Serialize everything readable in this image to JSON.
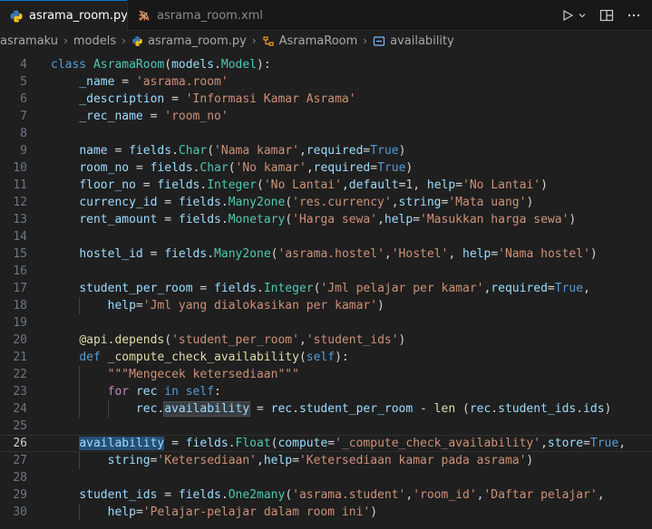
{
  "tabs": [
    {
      "label": "asrama_room.py",
      "icon": "python-icon",
      "active": true,
      "close": "×"
    },
    {
      "label": "asrama_room.xml",
      "icon": "rss-icon",
      "active": false
    }
  ],
  "toolbar": {
    "run_icon": "play-icon",
    "dropdown_icon": "chevron-down-icon",
    "split_icon": "split-editor-icon",
    "more_icon": "ellipsis-icon"
  },
  "breadcrumb": [
    {
      "label": "asramaku",
      "icon": ""
    },
    {
      "label": "models",
      "icon": ""
    },
    {
      "label": "asrama_room.py",
      "icon": "python-icon"
    },
    {
      "label": "AsramaRoom",
      "icon": "class-icon"
    },
    {
      "label": "availability",
      "icon": "field-icon"
    }
  ],
  "colors": {
    "accent": "#0078d4",
    "background": "#1f1f1f",
    "keyword": "#569cd6",
    "string": "#ce9178",
    "class": "#4ec9b0",
    "function": "#dcdcaa",
    "variable": "#9cdcfe"
  },
  "editor": {
    "current_line": 26,
    "lines": [
      {
        "n": "4",
        "text": "class AsramaRoom(models.Model):"
      },
      {
        "n": "5",
        "text": "    _name = 'asrama.room'"
      },
      {
        "n": "6",
        "text": "    _description = 'Informasi Kamar Asrama'"
      },
      {
        "n": "7",
        "text": "    _rec_name = 'room_no'"
      },
      {
        "n": "8",
        "text": ""
      },
      {
        "n": "9",
        "text": "    name = fields.Char('Nama kamar',required=True)"
      },
      {
        "n": "10",
        "text": "    room_no = fields.Char('No kamar',required=True)"
      },
      {
        "n": "11",
        "text": "    floor_no = fields.Integer('No Lantai',default=1, help='No Lantai')"
      },
      {
        "n": "12",
        "text": "    currency_id = fields.Many2one('res.currency',string='Mata uang')"
      },
      {
        "n": "13",
        "text": "    rent_amount = fields.Monetary('Harga sewa',help='Masukkan harga sewa')"
      },
      {
        "n": "14",
        "text": ""
      },
      {
        "n": "15",
        "text": "    hostel_id = fields.Many2one('asrama.hostel','Hostel', help='Nama hostel')"
      },
      {
        "n": "16",
        "text": ""
      },
      {
        "n": "17",
        "text": "    student_per_room = fields.Integer('Jml pelajar per kamar',required=True,"
      },
      {
        "n": "18",
        "text": "        help='Jml yang dialokasikan per kamar')"
      },
      {
        "n": "19",
        "text": ""
      },
      {
        "n": "20",
        "text": "    @api.depends('student_per_room','student_ids')"
      },
      {
        "n": "21",
        "text": "    def _compute_check_availability(self):"
      },
      {
        "n": "22",
        "text": "        \"\"\"Mengecek ketersediaan\"\"\""
      },
      {
        "n": "23",
        "text": "        for rec in self:"
      },
      {
        "n": "24",
        "text": "            rec.availability = rec.student_per_room - len (rec.student_ids.ids)"
      },
      {
        "n": "25",
        "text": ""
      },
      {
        "n": "26",
        "text": "    availability = fields.Float(compute='_compute_check_availability',store=True,"
      },
      {
        "n": "27",
        "text": "        string='Ketersediaan',help='Ketersediaan kamar pada asrama')"
      },
      {
        "n": "28",
        "text": ""
      },
      {
        "n": "29",
        "text": "    student_ids = fields.One2many('asrama.student','room_id','Daftar pelajar',"
      },
      {
        "n": "30",
        "text": "        help='Pelajar-pelajar dalam room ini')"
      }
    ]
  }
}
